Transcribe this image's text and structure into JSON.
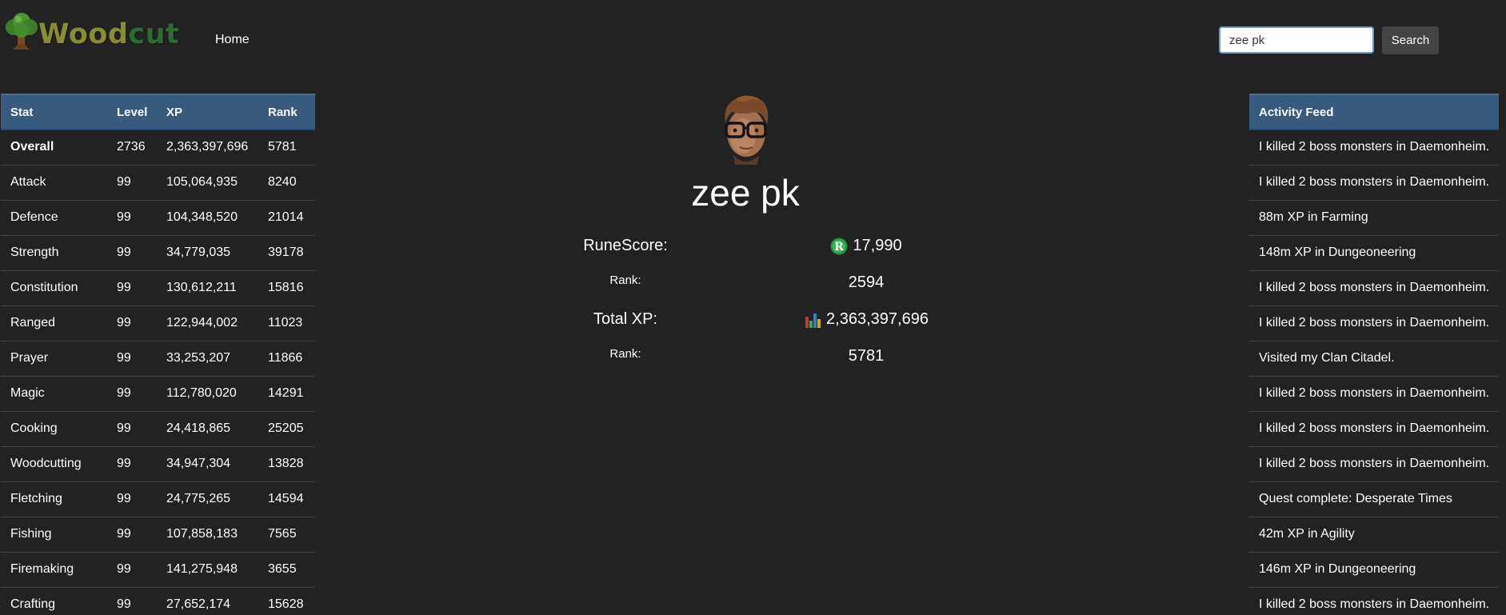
{
  "header": {
    "logo_part1": "Wood",
    "logo_part2": "cut",
    "nav_home": "Home",
    "search_value": "zee pk",
    "search_button": "Search"
  },
  "stats": {
    "headers": [
      "Stat",
      "Level",
      "XP",
      "Rank"
    ],
    "rows": [
      [
        "Overall",
        "2736",
        "2,363,397,696",
        "5781"
      ],
      [
        "Attack",
        "99",
        "105,064,935",
        "8240"
      ],
      [
        "Defence",
        "99",
        "104,348,520",
        "21014"
      ],
      [
        "Strength",
        "99",
        "34,779,035",
        "39178"
      ],
      [
        "Constitution",
        "99",
        "130,612,211",
        "15816"
      ],
      [
        "Ranged",
        "99",
        "122,944,002",
        "11023"
      ],
      [
        "Prayer",
        "99",
        "33,253,207",
        "11866"
      ],
      [
        "Magic",
        "99",
        "112,780,020",
        "14291"
      ],
      [
        "Cooking",
        "99",
        "24,418,865",
        "25205"
      ],
      [
        "Woodcutting",
        "99",
        "34,947,304",
        "13828"
      ],
      [
        "Fletching",
        "99",
        "24,775,265",
        "14594"
      ],
      [
        "Fishing",
        "99",
        "107,858,183",
        "7565"
      ],
      [
        "Firemaking",
        "99",
        "141,275,948",
        "3655"
      ],
      [
        "Crafting",
        "99",
        "27,652,174",
        "15628"
      ]
    ]
  },
  "profile": {
    "name": "zee pk",
    "runescore_label": "RuneScore:",
    "runescore_value": "17,990",
    "runescore_rank_label": "Rank:",
    "runescore_rank_value": "2594",
    "totalxp_label": "Total XP:",
    "totalxp_value": "2,363,397,696",
    "totalxp_rank_label": "Rank:",
    "totalxp_rank_value": "5781"
  },
  "feed": {
    "header": "Activity Feed",
    "items": [
      "I killed 2 boss monsters in Daemonheim.",
      "I killed 2 boss monsters in Daemonheim.",
      "88m XP in Farming",
      "148m XP in Dungeoneering",
      "I killed 2 boss monsters in Daemonheim.",
      "I killed 2 boss monsters in Daemonheim.",
      "Visited my Clan Citadel.",
      "I killed 2 boss monsters in Daemonheim.",
      "I killed 2 boss monsters in Daemonheim.",
      "I killed 2 boss monsters in Daemonheim.",
      "Quest complete: Desperate Times",
      "42m XP in Agility",
      "146m XP in Dungeoneering",
      "I killed 2 boss monsters in Daemonheim."
    ]
  },
  "icons": {
    "logo": "tree-icon",
    "runescore": "runescore-icon",
    "totalxp": "bar-chart-icon",
    "avatar": "player-avatar"
  },
  "colors": {
    "background": "#222222",
    "table_header": "#375a7f",
    "logo_wood": "#8a8c34",
    "logo_cut": "#2f6a33"
  }
}
